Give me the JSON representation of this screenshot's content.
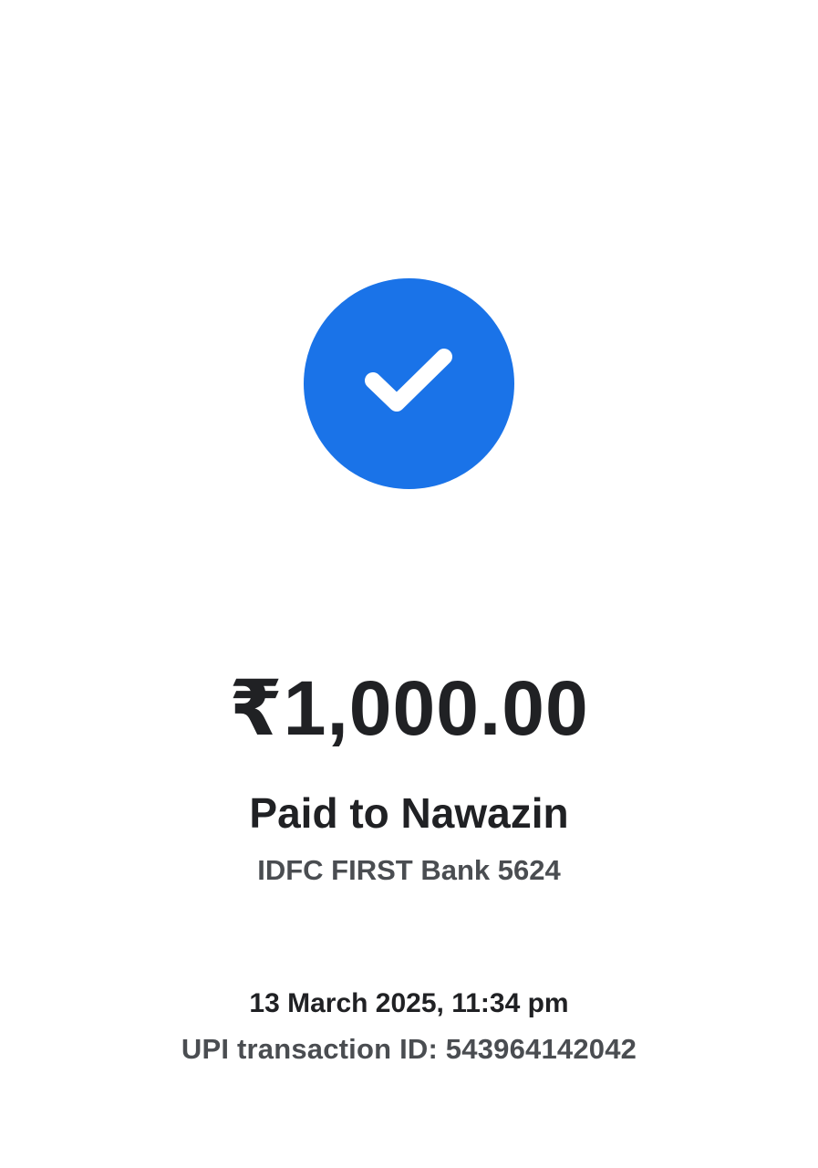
{
  "payment": {
    "amount": "₹1,000.00",
    "paid_to": "Paid to Nawazin",
    "bank": "IDFC FIRST Bank 5624",
    "datetime": "13 March 2025, 11:34 pm",
    "transaction_id": "UPI transaction ID: 543964142042"
  },
  "icons": {
    "success": "check-circle-icon"
  },
  "colors": {
    "accent": "#1a73e8",
    "text_primary": "#202124",
    "text_secondary": "#4a4d51",
    "background": "#ffffff"
  }
}
